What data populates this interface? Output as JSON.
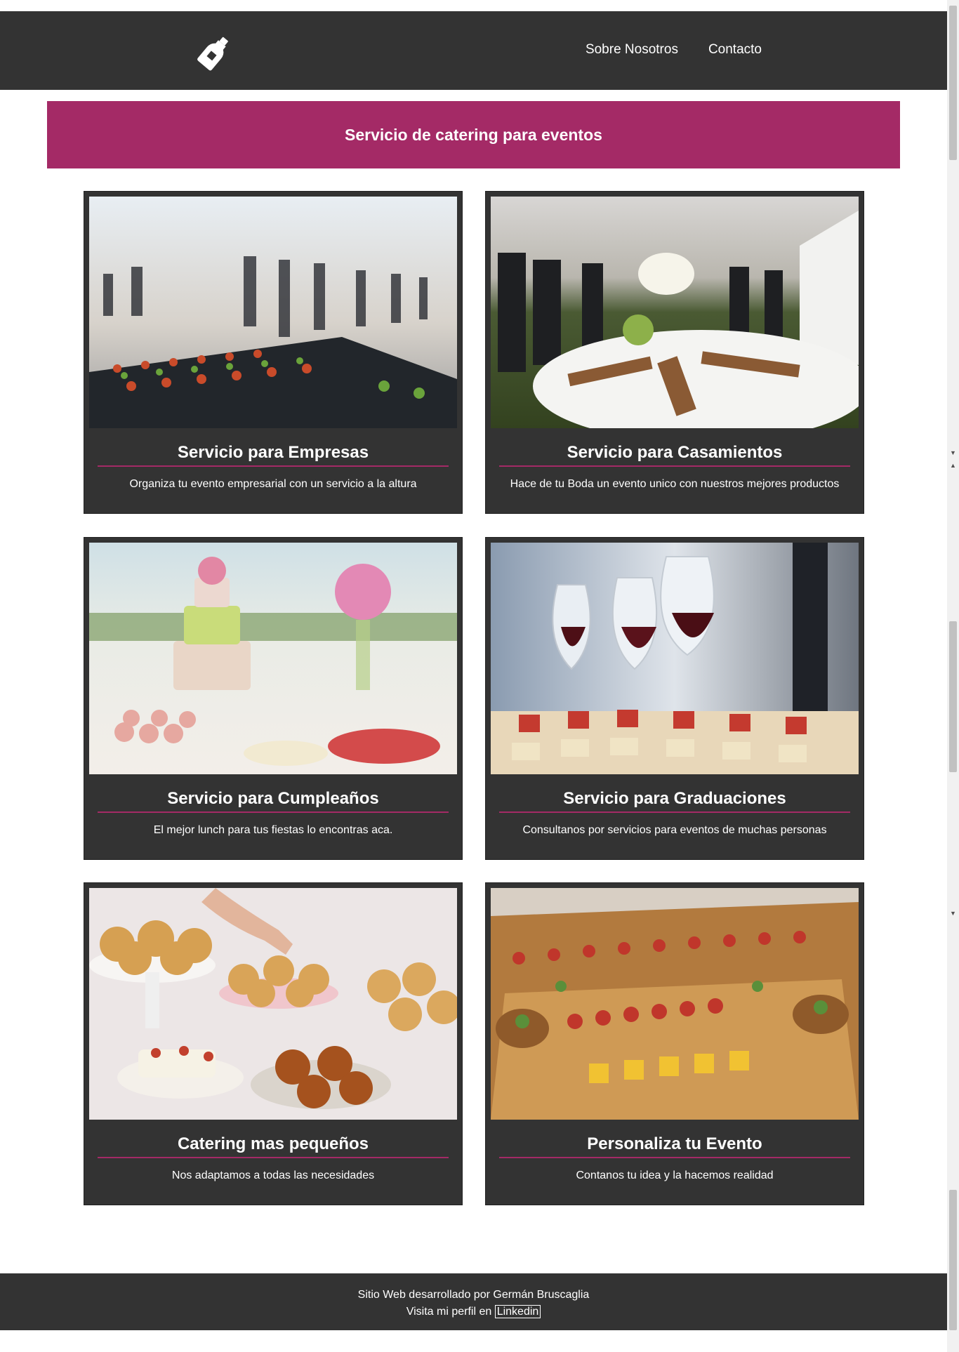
{
  "nav": {
    "links": [
      "Sobre Nosotros",
      "Contacto"
    ]
  },
  "banner": {
    "title": "Servicio de catering para eventos"
  },
  "cards": [
    {
      "title": "Servicio para Empresas",
      "text": "Organiza tu evento empresarial con un servicio a la altura"
    },
    {
      "title": "Servicio para Casamientos",
      "text": "Hace de tu Boda un evento unico con nuestros mejores productos"
    },
    {
      "title": "Servicio para Cumpleaños",
      "text": "El mejor lunch para tus fiestas lo encontras aca."
    },
    {
      "title": "Servicio para Graduaciones",
      "text": "Consultanos por servicios para eventos de muchas personas"
    },
    {
      "title": "Catering mas pequeños",
      "text": "Nos adaptamos a todas las necesidades"
    },
    {
      "title": "Personaliza tu Evento",
      "text": "Contanos tu idea y la hacemos realidad"
    }
  ],
  "footer": {
    "line1": "Sitio Web desarrollado por Germán Bruscaglia",
    "line2_prefix": "Visita mi perfil en",
    "link": "Linkedin"
  },
  "icons": {
    "logo": "wine-bottle-icon"
  },
  "colors": {
    "dark": "#333333",
    "accent": "#a42a66",
    "text": "#ffffff"
  }
}
